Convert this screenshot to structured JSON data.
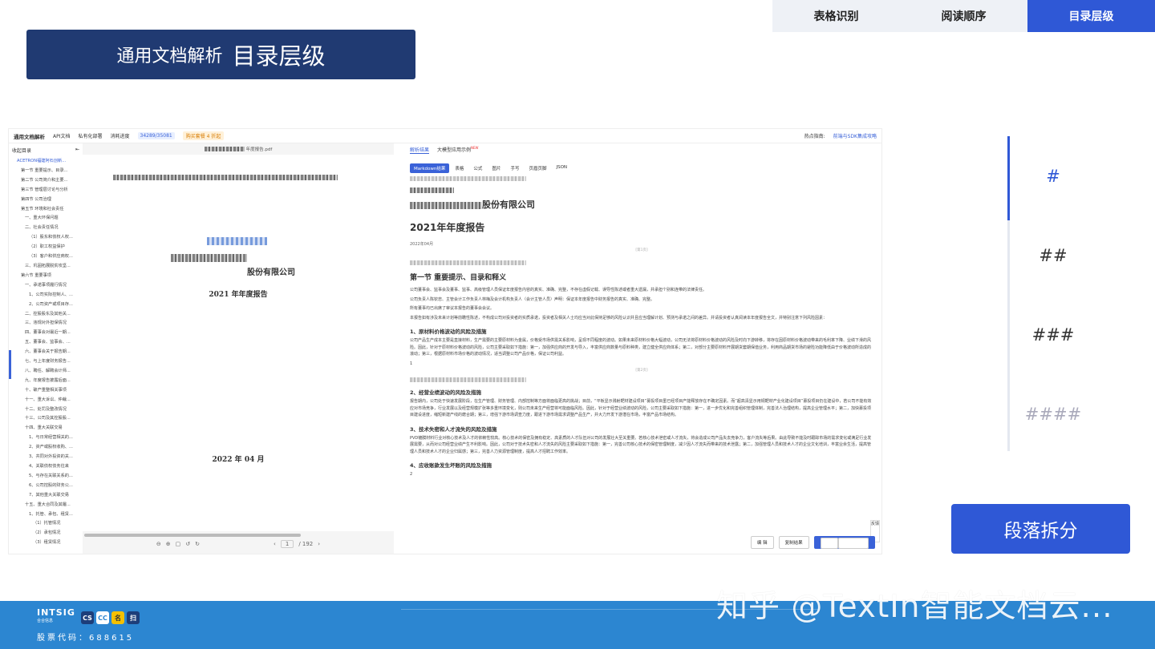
{
  "header_tabs": [
    {
      "label": "表格识别"
    },
    {
      "label": "阅读顺序"
    },
    {
      "label": "目录层级",
      "active": true
    }
  ],
  "title": {
    "main": "通用文档解析",
    "sub": "目录层级"
  },
  "app": {
    "nav": {
      "brand": "通用文档解析",
      "api": "API文档",
      "deploy": "私有化部署",
      "usage_label": "消耗进度",
      "usage": "34289/35081",
      "promo": "购买套餐 4 折起",
      "hint_label": "热点指南:",
      "hint_link": "前端与SDK集成攻略"
    },
    "toc": {
      "header": "收起目录",
      "items": [
        {
          "label": "ACETRON福建阿石创新...",
          "level": 0
        },
        {
          "label": "第一节 重要提示、目录...",
          "level": 1
        },
        {
          "label": "第二节 公司简介和主要...",
          "level": 1
        },
        {
          "label": "第三节 管理层讨论与分析",
          "level": 1
        },
        {
          "label": "第四节 公司治理",
          "level": 1
        },
        {
          "label": "第五节 环境和社会责任",
          "level": 1
        },
        {
          "label": "一、重大环保问题",
          "level": 2
        },
        {
          "label": "二、社会责任情况",
          "level": 2
        },
        {
          "label": "（1）股东和债权人权...",
          "level": 3
        },
        {
          "label": "（2）职工权益保护",
          "level": 3
        },
        {
          "label": "（3）客户和供应商权...",
          "level": 3
        },
        {
          "label": "三、巩固拓展脱贫攻坚...",
          "level": 2
        },
        {
          "label": "第六节 重要事项",
          "level": 1
        },
        {
          "label": "一、承诺事项履行情况",
          "level": 2
        },
        {
          "label": "1、公司实际控制人、...",
          "level": 3
        },
        {
          "label": "2、公司资产或项目存...",
          "level": 3
        },
        {
          "label": "二、控股股东及其他关...",
          "level": 2
        },
        {
          "label": "三、违规对外担保情况",
          "level": 2
        },
        {
          "label": "四、董事会对最近一期...",
          "level": 2
        },
        {
          "label": "五、董事会、监事会、...",
          "level": 2
        },
        {
          "label": "六、董事会关于报告期...",
          "level": 2
        },
        {
          "label": "七、与上年度财务报告...",
          "level": 2
        },
        {
          "label": "八、聘任、解聘会计师...",
          "level": 2
        },
        {
          "label": "九、年度报告披露后面...",
          "level": 2
        },
        {
          "label": "十、破产重整相关事项",
          "level": 2
        },
        {
          "label": "十一、重大诉讼、仲裁...",
          "level": 2
        },
        {
          "label": "十二、处罚及整改情况",
          "level": 2
        },
        {
          "label": "十三、公司及其控股股...",
          "level": 2
        },
        {
          "label": "十四、重大关联交易",
          "level": 2
        },
        {
          "label": "1、与日常经营相关的...",
          "level": 3
        },
        {
          "label": "2、资产或股权收购、...",
          "level": 3
        },
        {
          "label": "3、共同对外投资的关...",
          "level": 3
        },
        {
          "label": "4、关联债权债务往来",
          "level": 3
        },
        {
          "label": "5、与存在关联关系的...",
          "level": 3
        },
        {
          "label": "6、公司控股的财务公...",
          "level": 3
        },
        {
          "label": "7、其他重大关联交易",
          "level": 3
        },
        {
          "label": "十五、重大合同及其履...",
          "level": 2
        },
        {
          "label": "1、托管、承包、租赁...",
          "level": 3
        },
        {
          "label": "（1）托管情况",
          "level": 4
        },
        {
          "label": "（2）承包情况",
          "level": 4
        },
        {
          "label": "（3）租赁情况",
          "level": 4
        }
      ]
    },
    "pdf": {
      "filename": "年度报告.pdf",
      "company": "股份有限公司",
      "report": "2021 年年度报告",
      "date": "2022 年 04 月",
      "page": "1",
      "total": "/ 192"
    },
    "result": {
      "tabs": [
        "解析结果",
        "大模型应用示例"
      ],
      "new": "NEW",
      "formats": [
        "Markdown结果",
        "表格",
        "公式",
        "图片",
        "手写",
        "页眉页脚",
        "JSON"
      ],
      "company": "股份有限公司",
      "report": "2021年年度报告",
      "date": "2022年04月",
      "page1": "[第1页]",
      "page2": "[第2页]",
      "section1": "第一节 重要提示、目录和释义",
      "p1": "公司董事会、监事会及董事、监事、高级管理人员保证年度报告内容的真实、准确、完整，不存在虚假记载、误导性陈述或者重大遗漏，并承担个别和连带的法律责任。",
      "p2": "公司负责人陈钦忠、主管会计工作负责人林梅及会计机构负责人（会计主管人员）声明：保证本年度报告中财务报告的真实、准确、完整。",
      "p3": "所有董事均已出席了审议本报告的董事会会议。",
      "p4": "本报告如有涉及未来计划等前瞻性陈述，不构成公司对投资者的实质承诺，投资者及相关人士均应当对此保持足够的风险认识并且应当理解计划、预测与承诺之间的差异。并请投资者认真阅读本年度报告全文，并特别注意下列风险因素：",
      "r1": "1、原材料价格波动的风险及措施",
      "p5": "公司产品生产成本主要是直接材料，生产需要的主要原材料为金属，价格受市场供需关系影响，呈现不同程度的波动。如果未来原材料价格大幅波动，公司无法将原材料价格波动的风险及时向下游转移，将存在因原材料价格波动带来的毛利率下降、业绩下滑的风险。因此，针对于原材料价格波动的风险，公司主要采取如下措施：第一，加强供应商的开发与导入，丰富供应商数量与原料种类，建立健全供应商体系；第二，对部分主要原材料开展期货套期保值业务，利用商品期货市场的避险功能降低由于价格波动所造成的滚动；第三，根据原材料市场价格的波动情况，适当调整公司产品价格，保证公司利益。",
      "n1": "1",
      "r2": "2、经营业绩波动的风险及措施",
      "p6": "报告期内，公司处于快速发展阶段，在生产管理、财务管理、内部控制等方面将面临更高的挑战；目前，“平板显示溅射靶材建设项目”募投项目虽已经项目产能释放存在不确定因素。而“超高清显示用铜靶材产业化建设项目”募投项目仍在建设中，若公司不能有效应对市场竞争，行业发展以及经营规模扩张等多重环境变化，则公司未来生产经营将可能面临风险。因此，针对于经营业绩波动的风险，公司主要采取如下措施：第一，进一步优化和完善组织管理体制，完善法人治理结构，提高企业管理水平；第二，加快募投项目建设进度，缩短新建产线的磨合期；第三，增强下游市场调查力度，跟进下游市场需求调整产品生产，并大力开发下游潜在市场，丰富产品市场结构。",
      "r3": "3、技术失密和人才流失的风险及措施",
      "p7": "PVD镀膜材料行业对核心技术及人才的依赖性较高。核心技术的保密及拥有稳定、高素质的人才队伍对公司的发展壮大至关重要。若核心技术泄密或人才流失，将会造成公司产品失去竞争力，客户流失等后果。由此导致不能及时跟踪市场的需求变化或满足行业发展需要，从而对公司经营业绩产生不利影响。因此，公司对于技术失密和人才流失的风险主要采取如下措施：第一，完善公司核心技术的保密管理制度，减少因人才流失而带来的技术泄露；第二，加强管理人员和技术人才的企业文化培训，丰富业余生活，提高管理人员和技术人才的企业归属感；第三，完善人力资源管理制度，提高人才招聘工作效率。",
      "r4": "4、应收账款发生坏账的风险及措施",
      "n2": "2",
      "feedback": "反馈",
      "actions": {
        "edit": "编 辑",
        "copy": "复制结果",
        "export": "导出结果"
      }
    }
  },
  "levels": [
    "#",
    "##",
    "###",
    "####"
  ],
  "segment_button": "段落拆分",
  "footer": {
    "brand": "INTSIG",
    "brand_sub": "合合信息",
    "stock": "股票代码：688615",
    "apps": [
      "CS",
      "CC",
      "名",
      "扫"
    ]
  },
  "watermark": "知乎 @TextIn智能文档云..."
}
